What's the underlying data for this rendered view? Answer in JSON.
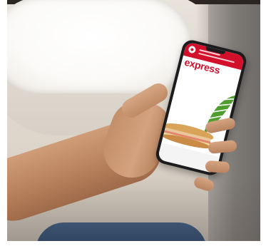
{
  "photo": {
    "subject": "hand-holding-phone-by-airplane-window"
  },
  "phone_app": {
    "brand_word": "express",
    "brand_color": "#d3102c",
    "icons": [
      "logo-icon",
      "leaf-icon",
      "sandwich-icon"
    ]
  }
}
